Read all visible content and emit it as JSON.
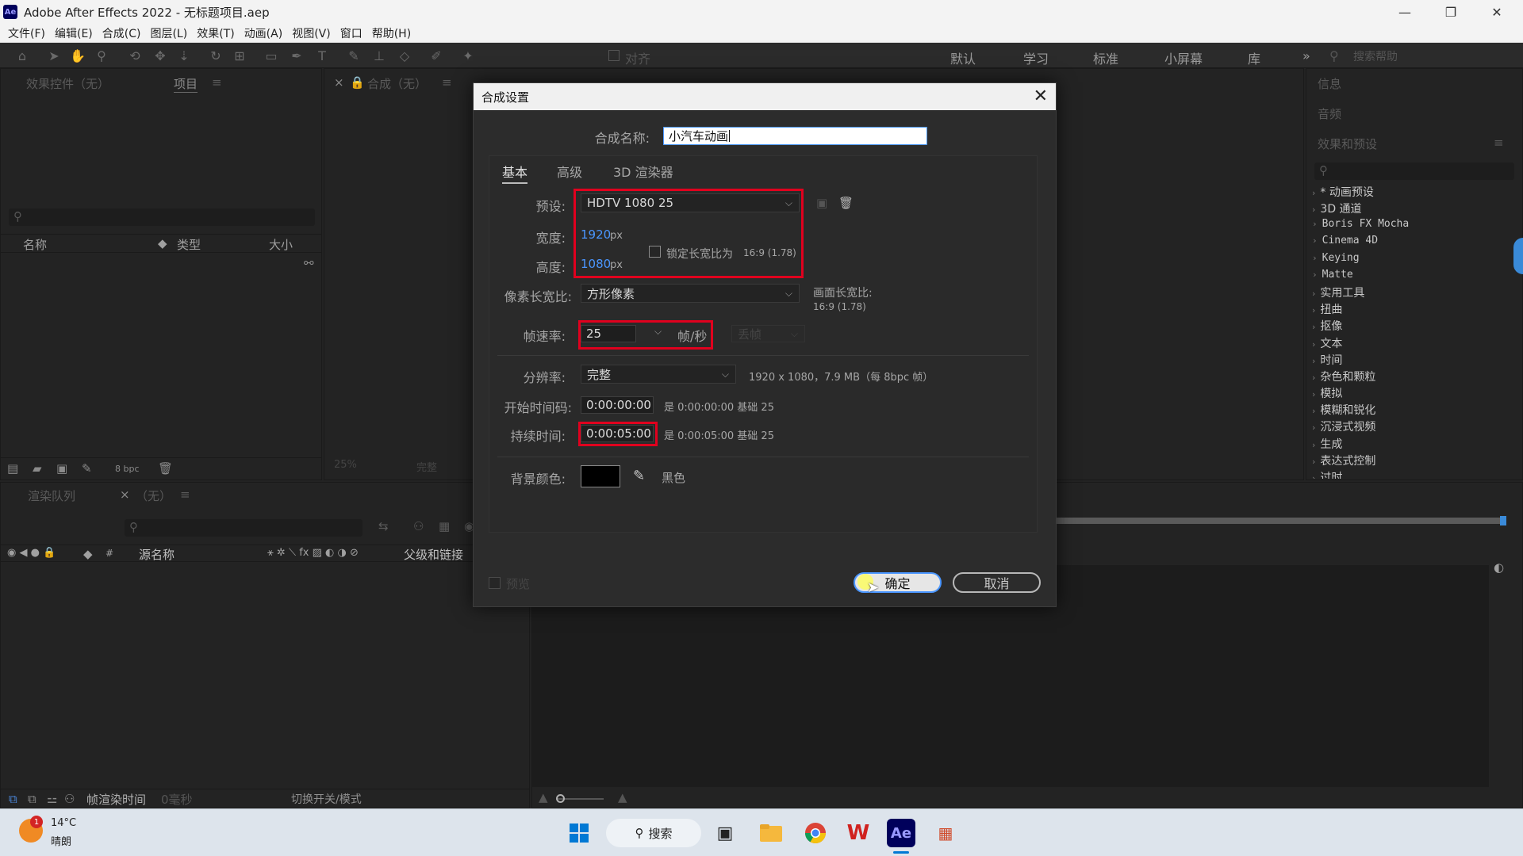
{
  "window": {
    "app_icon": "Ae",
    "title": "Adobe After Effects 2022 - 无标题项目.aep",
    "controls": {
      "minimize": "—",
      "restore": "❐",
      "close": "✕"
    }
  },
  "menu": [
    "文件(F)",
    "编辑(E)",
    "合成(C)",
    "图层(L)",
    "效果(T)",
    "动画(A)",
    "视图(V)",
    "窗口",
    "帮助(H)"
  ],
  "toolbar": {
    "align_label": "对齐",
    "workspaces": [
      "默认",
      "学习",
      "标准",
      "小屏幕",
      "库"
    ],
    "overflow": "»",
    "search_placeholder": "搜索帮助"
  },
  "left_panel": {
    "tab_effects": "效果控件（无）",
    "tab_project": "项目",
    "col_name": "名称",
    "col_type": "类型",
    "col_size": "大小",
    "bpc": "8 bpc"
  },
  "comp_panel": {
    "tab": "合成（无）",
    "zoom": "25%",
    "quality": "完整"
  },
  "right_panel": {
    "info": "信息",
    "audio": "音频",
    "effects_presets": "效果和预设",
    "items": [
      "* 动画预设",
      "3D 通道",
      "Boris FX Mocha",
      "Cinema 4D",
      "Keying",
      "Matte",
      "实用工具",
      "扭曲",
      "抠像",
      "文本",
      "时间",
      "杂色和颗粒",
      "模拟",
      "模糊和锐化",
      "沉浸式视频",
      "生成",
      "表达式控制",
      "过时"
    ]
  },
  "timeline": {
    "tab_render": "渲染队列",
    "tab_none": "（无）",
    "col_source": "源名称",
    "col_parent": "父级和链接",
    "frame_render_time": "帧渲染时间",
    "render_ms": "0毫秒",
    "toggle_modes": "切换开关/模式"
  },
  "dialog": {
    "title": "合成设置",
    "name_label": "合成名称:",
    "name_value": "小汽车动画",
    "tabs": [
      "基本",
      "高级",
      "3D 渲染器"
    ],
    "preset_label": "预设:",
    "preset_value": "HDTV 1080 25",
    "width_label": "宽度:",
    "width_value": "1920",
    "height_label": "高度:",
    "height_value": "1080",
    "px": "px",
    "lock_ratio": "锁定长宽比为",
    "lock_ratio_value": "16:9 (1.78)",
    "pixel_aspect_label": "像素长宽比:",
    "pixel_aspect_value": "方形像素",
    "frame_aspect_label": "画面长宽比:",
    "frame_aspect_value": "16:9 (1.78)",
    "fps_label": "帧速率:",
    "fps_value": "25",
    "fps_unit": "帧/秒",
    "drop_frame": "丢帧",
    "resolution_label": "分辨率:",
    "resolution_value": "完整",
    "resolution_info": "1920 x 1080，7.9 MB（每 8bpc 帧）",
    "start_tc_label": "开始时间码:",
    "start_tc_value": "0:00:00:00",
    "start_tc_info": "是 0:00:00:00  基础 25",
    "duration_label": "持续时间:",
    "duration_value": "0:00:05:00",
    "duration_info": "是 0:00:05:00  基础 25",
    "bg_label": "背景颜色:",
    "bg_color_name": "黑色",
    "bg_color": "#000000",
    "preview_label": "预览",
    "ok": "确定",
    "cancel": "取消"
  },
  "taskbar": {
    "weather_temp": "14°C",
    "weather_desc": "晴朗",
    "search_label": "搜索",
    "badge": "1",
    "ae_label": "Ae"
  }
}
